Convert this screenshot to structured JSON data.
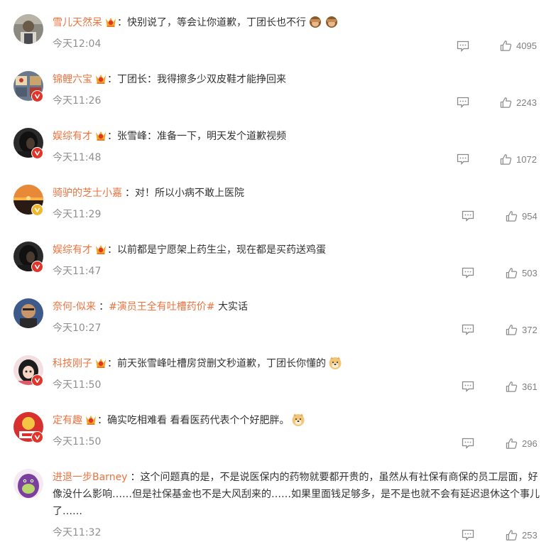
{
  "colors": {
    "username": "#eb7340",
    "text": "#333333",
    "time": "#8f8f8f",
    "count": "#808080",
    "badge_red": "#e0352b",
    "badge_gold": "#f2b62a"
  },
  "comments": [
    {
      "username": "雪儿天然呆",
      "vip": true,
      "badge": "none",
      "colon": "：",
      "text": "快别说了，等会让你道歉，丁团长也不行",
      "emoji": [
        "see-no-evil-monkey-emoji",
        "see-no-evil-monkey-emoji"
      ],
      "time": "今天12:04",
      "likes": "4095",
      "reply_icon": "comment-icon",
      "like_icon": "thumbs-up-icon"
    },
    {
      "username": "锦鲤六宝",
      "vip": true,
      "badge": "red",
      "colon": "：",
      "text": "丁团长：我得擦多少双皮鞋才能挣回来",
      "time": "今天11:26",
      "likes": "2243"
    },
    {
      "username": "娱综有才",
      "vip": true,
      "badge": "red",
      "colon": "：",
      "text": "张雪峰：准备一下，明天发个道歉视频",
      "time": "今天11:48",
      "likes": "1072"
    },
    {
      "username": "骑驴的芝士小嘉",
      "vip": false,
      "badge": "gold",
      "colon": "：",
      "text": "对！所以小病不敢上医院",
      "time": "今天11:29",
      "likes": "954"
    },
    {
      "username": "娱综有才",
      "vip": true,
      "badge": "red",
      "colon": "：",
      "text": "以前都是宁愿架上药生尘，现在都是买药送鸡蛋",
      "time": "今天11:47",
      "likes": "503"
    },
    {
      "username": "奈何-似来",
      "vip": false,
      "badge": "none",
      "colon": "：",
      "topic": "#演员王全有吐槽药价#",
      "text": " 大实话",
      "time": "今天10:27",
      "likes": "372"
    },
    {
      "username": "科技刚子",
      "vip": true,
      "badge": "red",
      "colon": "：",
      "text": "前天张雪峰吐槽房贷删文秒道歉，丁团长你懂的",
      "emoji": [
        "doge-emoji"
      ],
      "time": "今天11:50",
      "likes": "361"
    },
    {
      "username": "定有趣",
      "vip": true,
      "badge": "red",
      "colon": "：",
      "text": "确实吃相难看 看看医药代表个个好肥胖。",
      "emoji": [
        "doge-emoji"
      ],
      "time": "今天11:50",
      "likes": "296"
    },
    {
      "username": "进退一步Barney",
      "vip": false,
      "badge": "none",
      "colon": "：",
      "text": "这个问题真的是，不是说医保内的药物就要都开贵的，虽然从有社保有商保的员工层面，好像没什么影响……但是社保基金也不是大风刮来的……如果里面钱足够多，是不是也就不会有延迟退休这个事儿了……",
      "time": "今天11:32",
      "likes": "253"
    }
  ]
}
